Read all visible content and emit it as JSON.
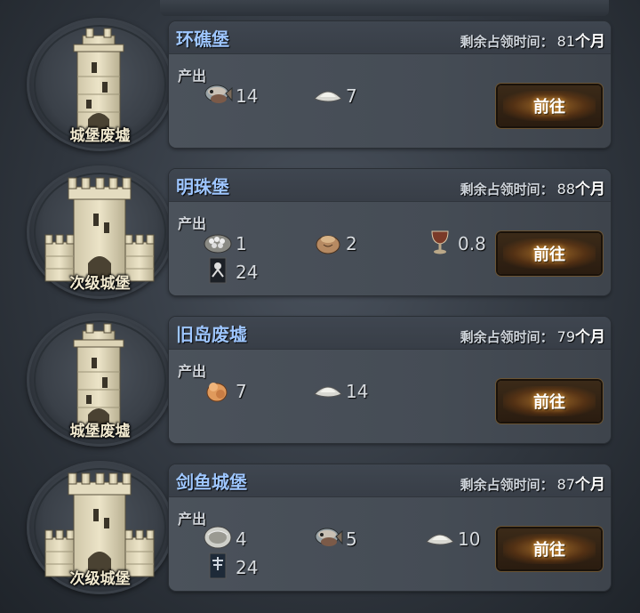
{
  "occupy_label": "剩余占领时间：",
  "occupy_unit": "个月",
  "produce_label": "产出",
  "go_label": "前往",
  "castles": [
    {
      "name": "环礁堡",
      "type": "城堡废墟",
      "months": "81",
      "resources": [
        {
          "icon": "fish-icon",
          "value": "14"
        },
        {
          "icon": "salt-icon",
          "value": "7"
        }
      ]
    },
    {
      "name": "明珠堡",
      "type": "次级城堡",
      "months": "88",
      "resources": [
        {
          "icon": "pearl-icon",
          "value": "1"
        },
        {
          "icon": "grain-sack-icon",
          "value": "2"
        },
        {
          "icon": "goblet-icon",
          "value": "0.8"
        },
        {
          "icon": "soldier-banner-icon",
          "value": "24"
        }
      ]
    },
    {
      "name": "旧岛废墟",
      "type": "城堡废墟",
      "months": "79",
      "resources": [
        {
          "icon": "coral-icon",
          "value": "7"
        },
        {
          "icon": "salt-icon",
          "value": "14"
        }
      ]
    },
    {
      "name": "剑鱼城堡",
      "type": "次级城堡",
      "months": "87",
      "resources": [
        {
          "icon": "oyster-icon",
          "value": "4"
        },
        {
          "icon": "fish-icon",
          "value": "5"
        },
        {
          "icon": "salt-icon",
          "value": "10"
        },
        {
          "icon": "troop-banner-icon",
          "value": "24"
        }
      ]
    }
  ]
}
